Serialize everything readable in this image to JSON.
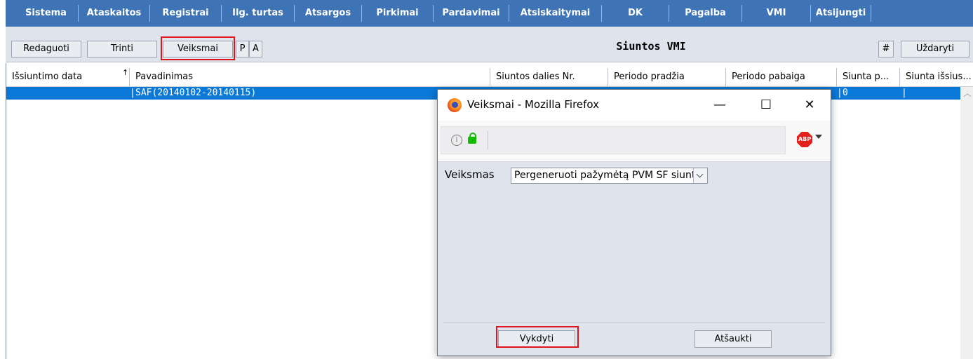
{
  "menu": {
    "items": [
      "Sistema",
      "Ataskaitos",
      "Registrai",
      "Ilg. turtas",
      "Atsargos",
      "Pirkimai",
      "Pardavimai",
      "Atsiskaitymai",
      "DK",
      "Pagalba",
      "VMI",
      "Atsijungti"
    ]
  },
  "toolbar": {
    "edit_label": "Redaguoti",
    "delete_label": "Trinti",
    "actions_label": "Veiksmai",
    "p_label": "P",
    "a_label": "A",
    "title": "Siuntos VMI",
    "hash_label": "#",
    "close_label": "Uždaryti"
  },
  "table": {
    "columns": [
      "Išsiuntimo data",
      "Pavadinimas",
      "Siuntos dalies Nr.",
      "Periodo pradžia",
      "Periodo pabaiga",
      "Siunta p...",
      "Siunta išsius..."
    ],
    "sort_indicator": "↑",
    "selected_row": {
      "name": "SAF(20140102-20140115)",
      "col6": "0"
    }
  },
  "dialog": {
    "title": "Veiksmai - Mozilla Firefox",
    "minimize": "—",
    "maximize": "☐",
    "close": "✕",
    "info": "i",
    "abp": "ABP",
    "field_label": "Veiksmas",
    "select_value": "Pergeneruoti pažymėtą PVM SF siuntą",
    "execute_label": "Vykdyti",
    "cancel_label": "Atšaukti"
  },
  "colors": {
    "menu_bg": "#3e74b5",
    "selection": "#0a78d7",
    "highlight": "#e0141b"
  }
}
